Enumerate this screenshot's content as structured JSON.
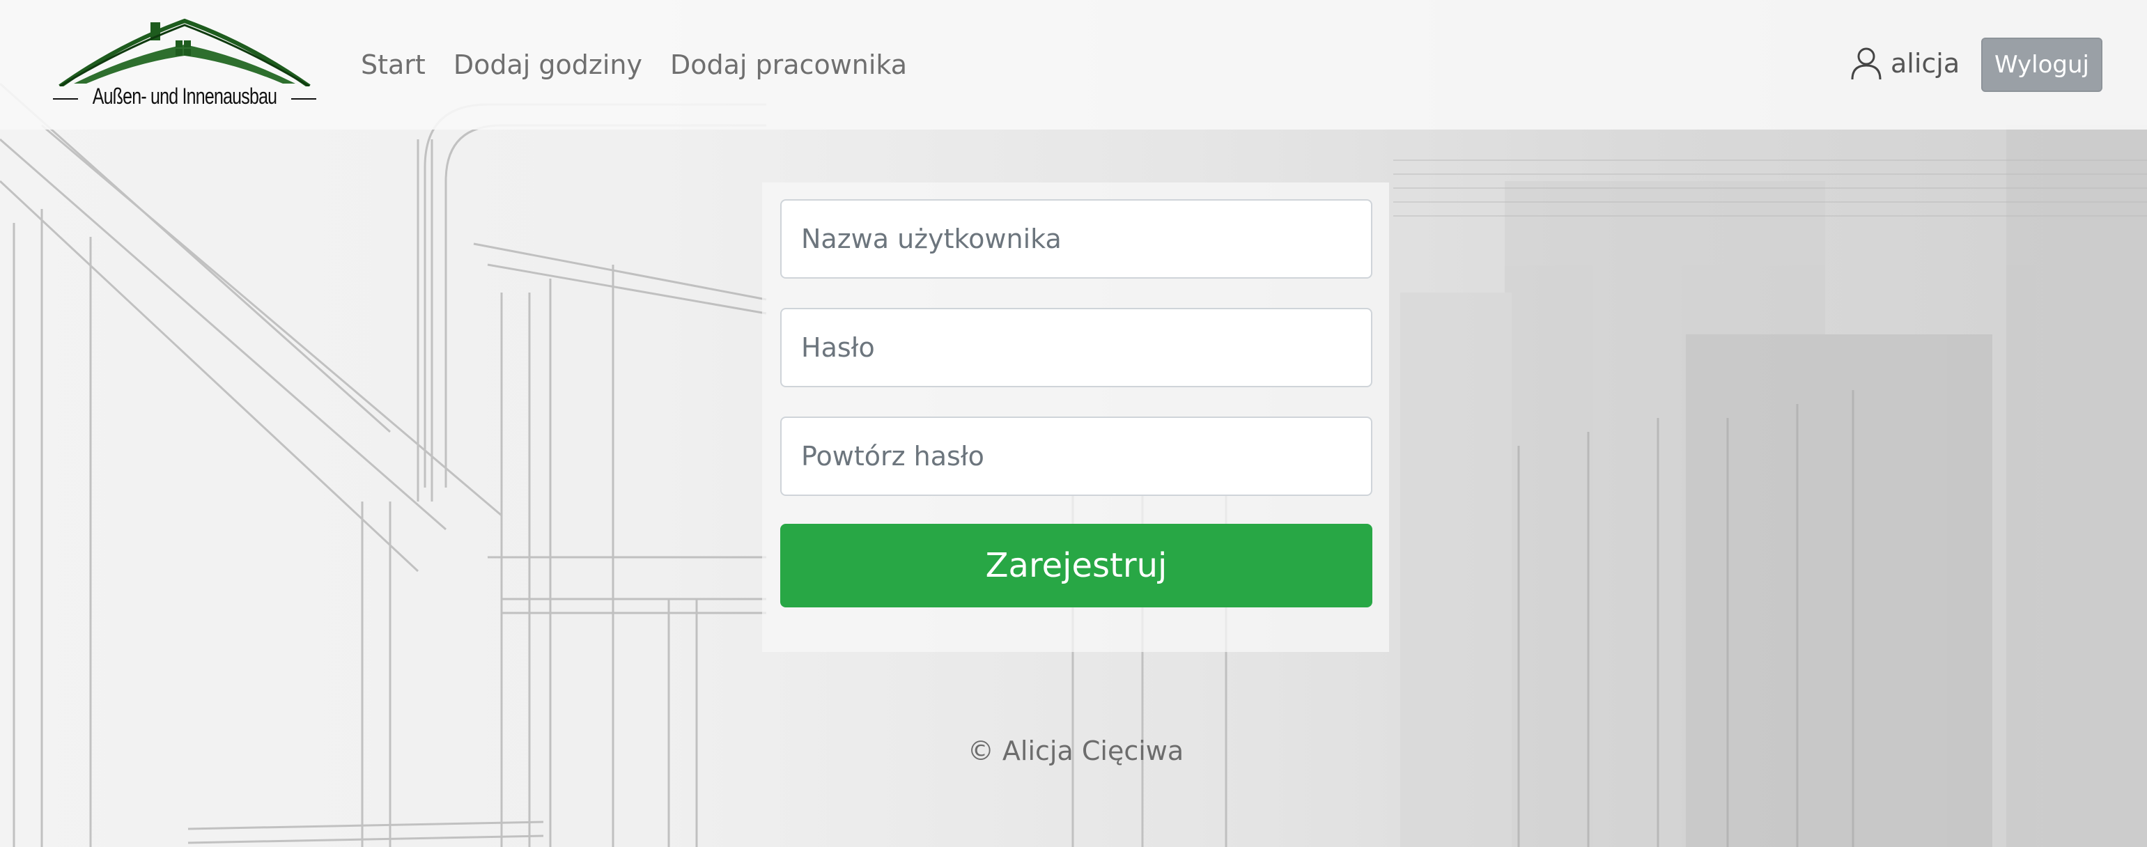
{
  "brand": {
    "name": "Außen- und Innenausbau",
    "logo_icon": "house-roof-logo"
  },
  "nav": {
    "links": [
      {
        "label": "Start"
      },
      {
        "label": "Dodaj godziny"
      },
      {
        "label": "Dodaj pracownika"
      }
    ]
  },
  "user": {
    "icon": "user-icon",
    "name": "alicja",
    "logout_label": "Wyloguj"
  },
  "form": {
    "username_placeholder": "Nazwa użytkownika",
    "password_placeholder": "Hasło",
    "repeat_password_placeholder": "Powtórz hasło",
    "submit_label": "Zarejestruj"
  },
  "footer": {
    "text": "© Alicja Cięciwa"
  },
  "colors": {
    "brand_green": "#1e5c1e",
    "submit_green": "#28a745",
    "logout_gray": "#9aa0a6",
    "nav_text": "#6f6f6f"
  }
}
